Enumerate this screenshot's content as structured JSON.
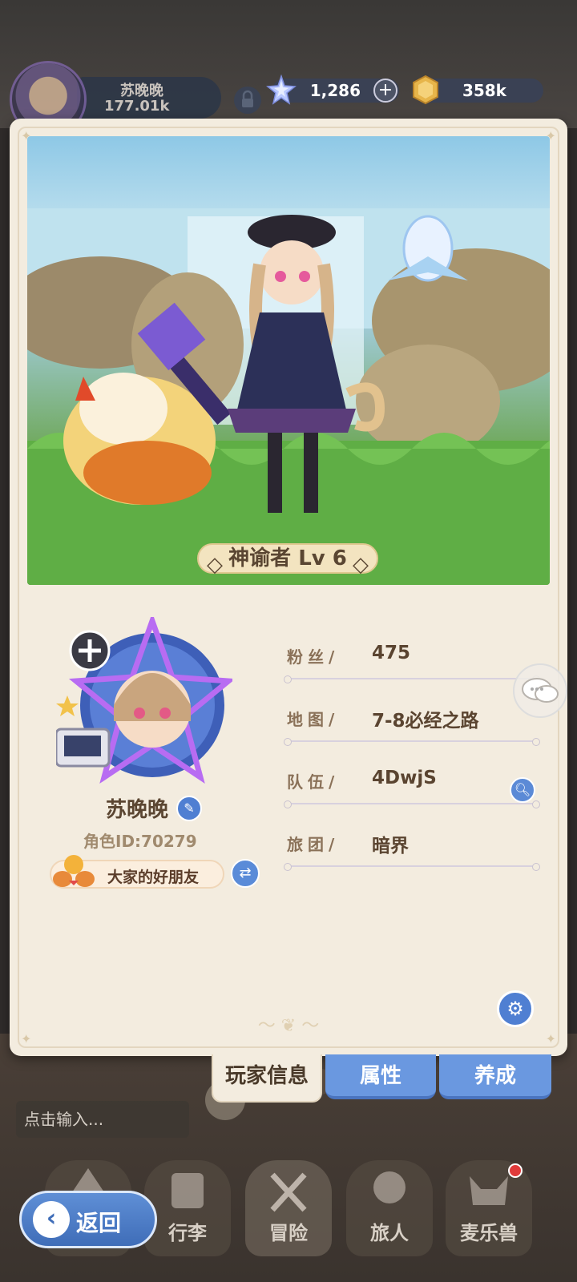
{
  "hud": {
    "player_name": "苏晚晚",
    "power": "177.01k",
    "gem_count": "1,286",
    "coin_count": "358k",
    "icons": [
      "lock-icon",
      "star-gem-icon",
      "plus-icon",
      "coin-icon"
    ]
  },
  "character": {
    "class_level": "神谕者 Lv 6"
  },
  "profile": {
    "name": "苏晚晚",
    "role_id": "角色ID:70279",
    "title": "大家的好朋友"
  },
  "info": [
    {
      "label": "粉丝/",
      "value": "475"
    },
    {
      "label": "地图/",
      "value": "7-8必经之路"
    },
    {
      "label": "队伍/",
      "value": "4DwjS"
    },
    {
      "label": "旅团/",
      "value": "暗界"
    }
  ],
  "tabs": {
    "player_info": "玩家信息",
    "attributes": "属性",
    "development": "养成"
  },
  "chat": {
    "placeholder": "点击输入..."
  },
  "nav": {
    "back": "返回",
    "items": [
      "行李",
      "冒险",
      "旅人",
      "麦乐兽"
    ]
  },
  "colors": {
    "accent_blue": "#5b8ad6",
    "card_bg": "#f3ecdf",
    "text_brown": "#5a4430",
    "badge_red": "#e03a3a"
  }
}
